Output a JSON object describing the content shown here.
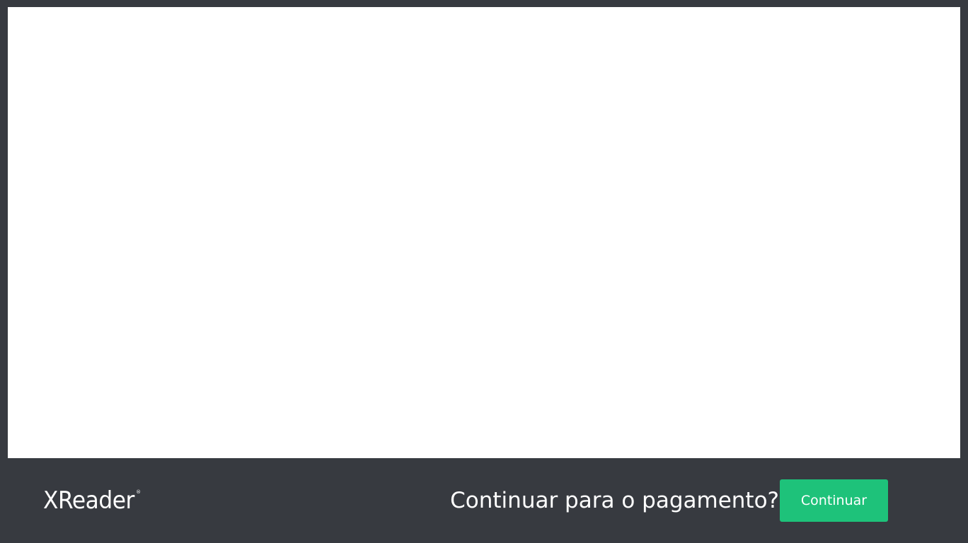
{
  "brand": {
    "name": "XReader",
    "registered_mark": "®"
  },
  "footer": {
    "prompt_text": "Continuar para o pagamento?",
    "continue_label": "Continuar"
  },
  "colors": {
    "background": "#373a40",
    "content_area": "#ffffff",
    "accent_button": "#1ec27a",
    "text": "#ffffff"
  }
}
